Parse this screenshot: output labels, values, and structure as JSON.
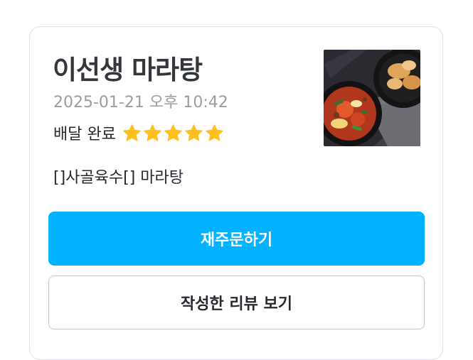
{
  "order": {
    "store_name": "이선생 마라탕",
    "date": "2025-01-21 오후 10:42",
    "status": "배달 완료",
    "rating": 5,
    "menu_summary": "[]사골육수[] 마라탕"
  },
  "thumbnail": {
    "icon": "food-photo"
  },
  "actions": {
    "reorder_label": "재주문하기",
    "view_review_label": "작성한 리뷰 보기"
  },
  "colors": {
    "accent": "#00b2ff",
    "star": "#ffc01e",
    "title": "#33363b",
    "muted": "#9a9ea5",
    "border": "#c4c8cd"
  }
}
